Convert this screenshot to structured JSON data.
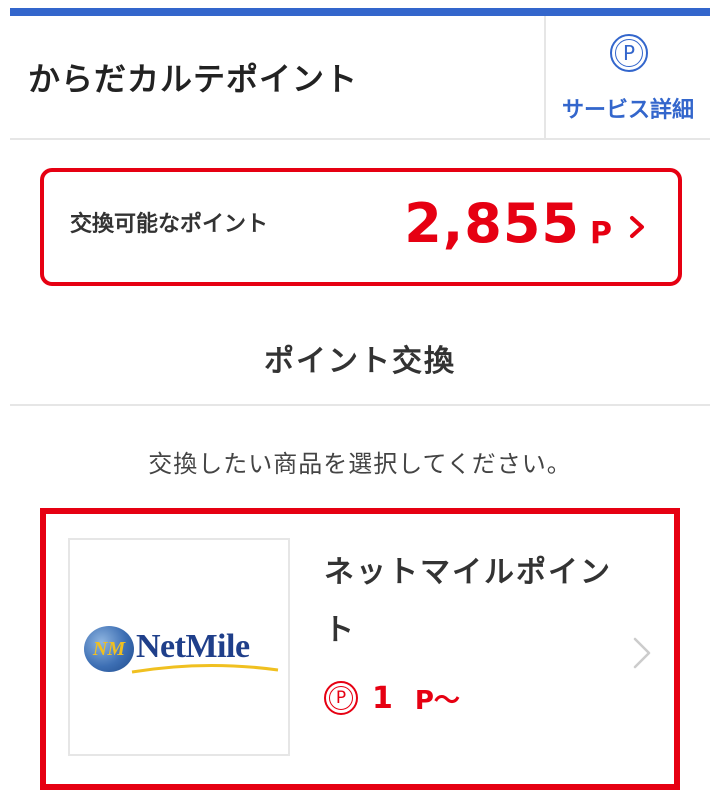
{
  "header": {
    "title": "からだカルテポイント",
    "service_icon_letter": "P",
    "service_label": "サービス詳細"
  },
  "points": {
    "label": "交換可能なポイント",
    "value": "2,855",
    "unit": "P"
  },
  "section": {
    "title": "ポイント交換",
    "instruction": "交換したい商品を選択してください。"
  },
  "products": [
    {
      "name": "ネットマイルポイント",
      "logo_mark": "NM",
      "logo_text": "NetMile",
      "price_icon_letter": "P",
      "price_value": "1",
      "price_unit": "P〜"
    }
  ],
  "colors": {
    "accent_blue": "#3366cc",
    "accent_red": "#e60012"
  }
}
